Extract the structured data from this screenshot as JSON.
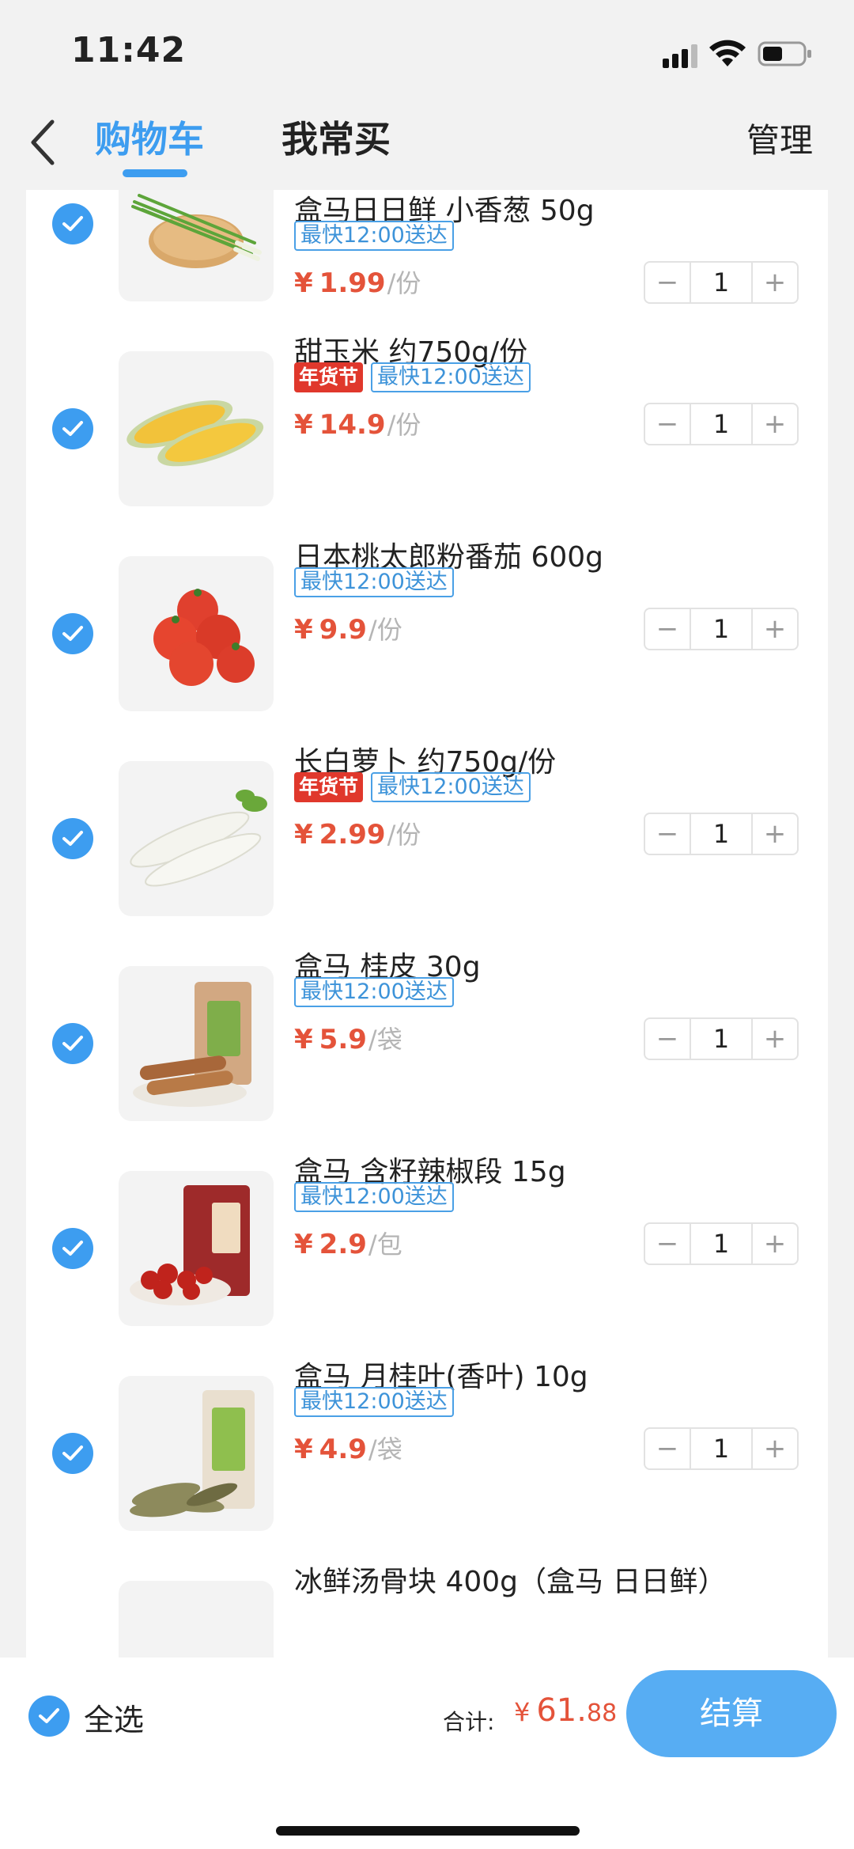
{
  "status_bar": {
    "time": "11:42"
  },
  "nav": {
    "tabs": [
      {
        "label": "购物车",
        "active": true
      },
      {
        "label": "我常买",
        "active": false
      }
    ],
    "manage_label": "管理"
  },
  "items": [
    {
      "title": "盒马日日鲜 小香葱 50g",
      "tags": [
        {
          "text": "最快12:00送达",
          "type": "delivery"
        }
      ],
      "currency": "¥",
      "price": "1.99",
      "unit": "/份",
      "quantity": "1",
      "checked": true,
      "image": "green-onion"
    },
    {
      "title": "甜玉米 约750g/份",
      "tags": [
        {
          "text": "年货节",
          "type": "promo"
        },
        {
          "text": "最快12:00送达",
          "type": "delivery"
        }
      ],
      "currency": "¥",
      "price": "14.9",
      "unit": "/份",
      "quantity": "1",
      "checked": true,
      "image": "corn"
    },
    {
      "title": "日本桃太郎粉番茄 600g",
      "tags": [
        {
          "text": "最快12:00送达",
          "type": "delivery"
        }
      ],
      "currency": "¥",
      "price": "9.9",
      "unit": "/份",
      "quantity": "1",
      "checked": true,
      "image": "tomato"
    },
    {
      "title": "长白萝卜 约750g/份",
      "tags": [
        {
          "text": "年货节",
          "type": "promo"
        },
        {
          "text": "最快12:00送达",
          "type": "delivery"
        }
      ],
      "currency": "¥",
      "price": "2.99",
      "unit": "/份",
      "quantity": "1",
      "checked": true,
      "image": "radish"
    },
    {
      "title": "盒马 桂皮 30g",
      "tags": [
        {
          "text": "最快12:00送达",
          "type": "delivery"
        }
      ],
      "currency": "¥",
      "price": "5.9",
      "unit": "/袋",
      "quantity": "1",
      "checked": true,
      "image": "cinnamon"
    },
    {
      "title": "盒马 含籽辣椒段 15g",
      "tags": [
        {
          "text": "最快12:00送达",
          "type": "delivery"
        }
      ],
      "currency": "¥",
      "price": "2.9",
      "unit": "/包",
      "quantity": "1",
      "checked": true,
      "image": "chili"
    },
    {
      "title": "盒马 月桂叶(香叶) 10g",
      "tags": [
        {
          "text": "最快12:00送达",
          "type": "delivery"
        }
      ],
      "currency": "¥",
      "price": "4.9",
      "unit": "/袋",
      "quantity": "1",
      "checked": true,
      "image": "bay-leaf"
    },
    {
      "title": "冰鲜汤骨块 400g（盒马 日日鲜）",
      "tags": [],
      "currency": "",
      "price": "",
      "unit": "",
      "quantity": "",
      "checked": false,
      "image": "soup-bone"
    }
  ],
  "stepper": {
    "minus": "−",
    "plus": "+"
  },
  "footer": {
    "select_all_label": "全选",
    "total_label": "合计:",
    "total_currency": "¥",
    "total_integer": "61.",
    "total_decimal": "88",
    "checkout_label": "结算"
  },
  "colors": {
    "accent": "#3d9df0",
    "price": "#e4533a",
    "promo_tag": "#e0382c"
  }
}
